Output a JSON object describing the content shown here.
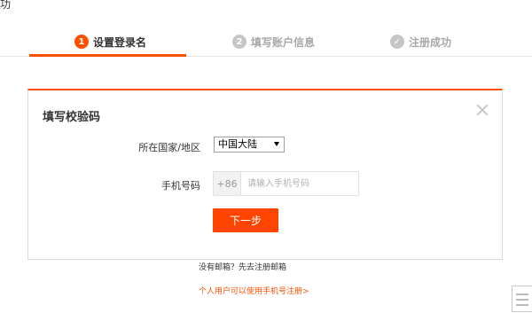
{
  "top_fragment": "功",
  "steps": [
    {
      "num": "1",
      "label": "设置登录名"
    },
    {
      "num": "2",
      "label": "填写账户信息"
    },
    {
      "num": "✓",
      "label": "注册成功"
    }
  ],
  "dialog": {
    "title": "填写校验码",
    "country_label": "所在国家/地区",
    "country_value": "中国大陆",
    "phone_label": "手机号码",
    "phone_prefix": "+86",
    "phone_placeholder": "请输入手机号码",
    "next_label": "下一步"
  },
  "links": {
    "no_email": "没有邮箱？先去注册邮箱",
    "personal": "个人用户可以使用手机号注册>"
  },
  "colors": {
    "accent": "#ff5000",
    "button": "#ff4400",
    "inactive": "#c6c6c6"
  },
  "icons": {
    "close": "close-icon",
    "dropdown": "chevron-down-icon",
    "check": "check-icon",
    "feedback": "feedback-icon"
  }
}
